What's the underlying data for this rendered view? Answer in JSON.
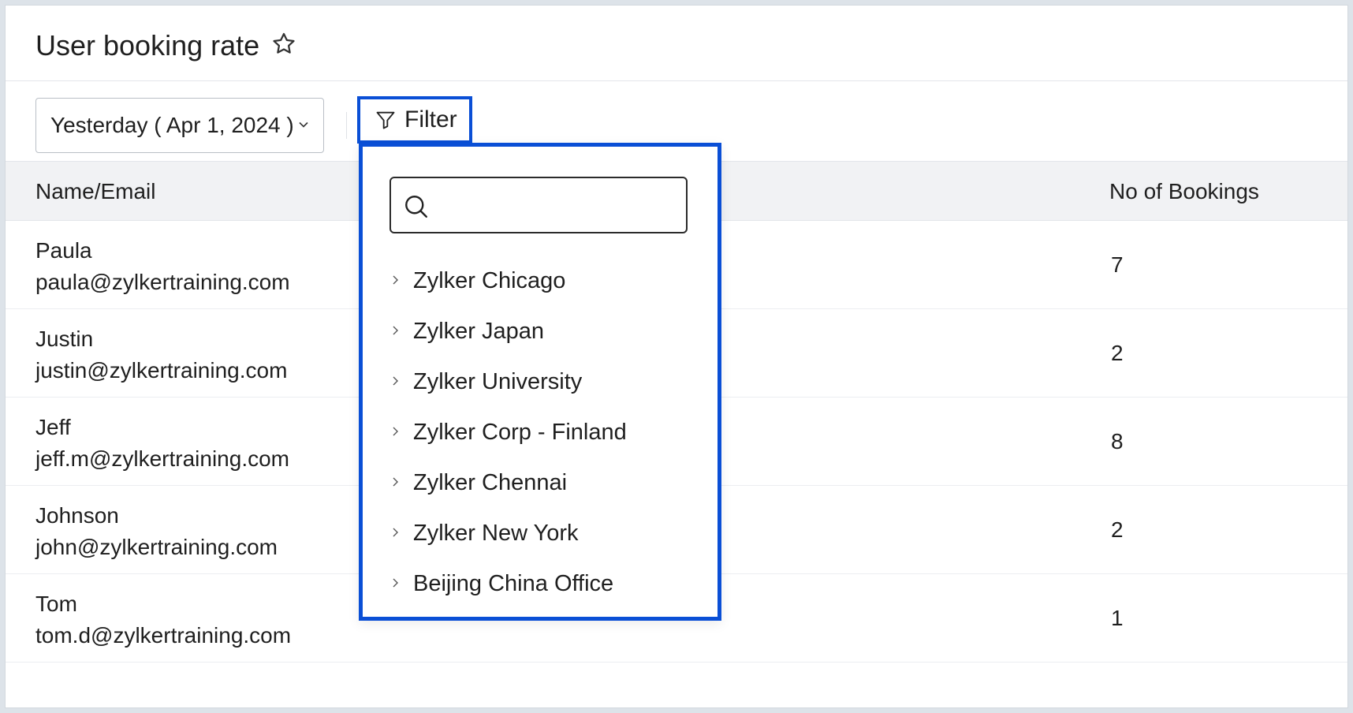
{
  "header": {
    "title": "User booking rate",
    "favorite_icon": "star-icon"
  },
  "toolbar": {
    "date_range": "Yesterday ( Apr 1, 2024 )",
    "filter_label": "Filter",
    "highlight_color": "#0a4fd6"
  },
  "table": {
    "columns": {
      "name": "Name/Email",
      "bookings": "No of Bookings"
    },
    "rows": [
      {
        "name": "Paula",
        "email": "paula@zylkertraining.com",
        "bookings": "7"
      },
      {
        "name": "Justin",
        "email": "justin@zylkertraining.com",
        "bookings": "2"
      },
      {
        "name": "Jeff",
        "email": "jeff.m@zylkertraining.com",
        "bookings": "8"
      },
      {
        "name": "Johnson",
        "email": "john@zylkertraining.com",
        "bookings": "2"
      },
      {
        "name": "Tom",
        "email": "tom.d@zylkertraining.com",
        "bookings": "1"
      }
    ]
  },
  "filter_panel": {
    "search_value": "",
    "groups": [
      "Zylker Chicago",
      "Zylker Japan",
      "Zylker University",
      "Zylker Corp - Finland",
      "Zylker Chennai",
      "Zylker New York",
      "Beijing China Office"
    ]
  }
}
